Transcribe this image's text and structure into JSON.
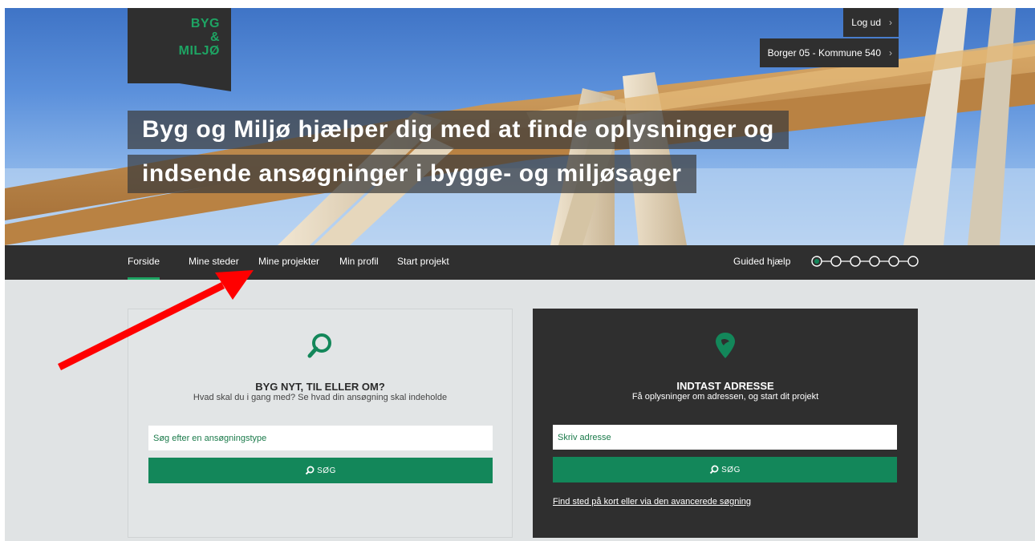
{
  "brand": {
    "logo_lines": [
      "BYG",
      "&",
      "MILJØ"
    ]
  },
  "header": {
    "logout_label": "Log ud",
    "citizen_label": "Borger 05 - Kommune 540",
    "headline_line1": "Byg og Miljø hjælper dig med at finde oplysninger og",
    "headline_line2": "indsende ansøgninger i bygge- og miljøsager"
  },
  "nav": {
    "items": [
      {
        "label": "Forside",
        "active": true
      },
      {
        "label": "Mine steder",
        "active": false
      },
      {
        "label": "Mine projekter",
        "active": false
      },
      {
        "label": "Min profil",
        "active": false
      },
      {
        "label": "Start projekt",
        "active": false
      }
    ],
    "guided_label": "Guided hjælp",
    "guided_steps": 6,
    "guided_current_step": 1
  },
  "search_card": {
    "icon": "search-icon",
    "title": "BYG NYT, TIL ELLER OM?",
    "subtitle": "Hvad skal du i gang med? Se hvad din ansøgning skal indeholde",
    "placeholder": "Søg efter en ansøgningstype",
    "button_label": "SØG"
  },
  "address_card": {
    "icon": "map-pin-icon",
    "title": "INDTAST ADRESSE",
    "subtitle": "Få oplysninger om adressen, og start dit projekt",
    "placeholder": "Skriv adresse",
    "button_label": "SØG",
    "link_label": "Find sted på kort eller via den avancerede søgning"
  },
  "colors": {
    "accent_green": "#13875a",
    "dark": "#2f2f2f",
    "background": "#e0e3e4",
    "annotation_arrow": "#ff0000"
  }
}
